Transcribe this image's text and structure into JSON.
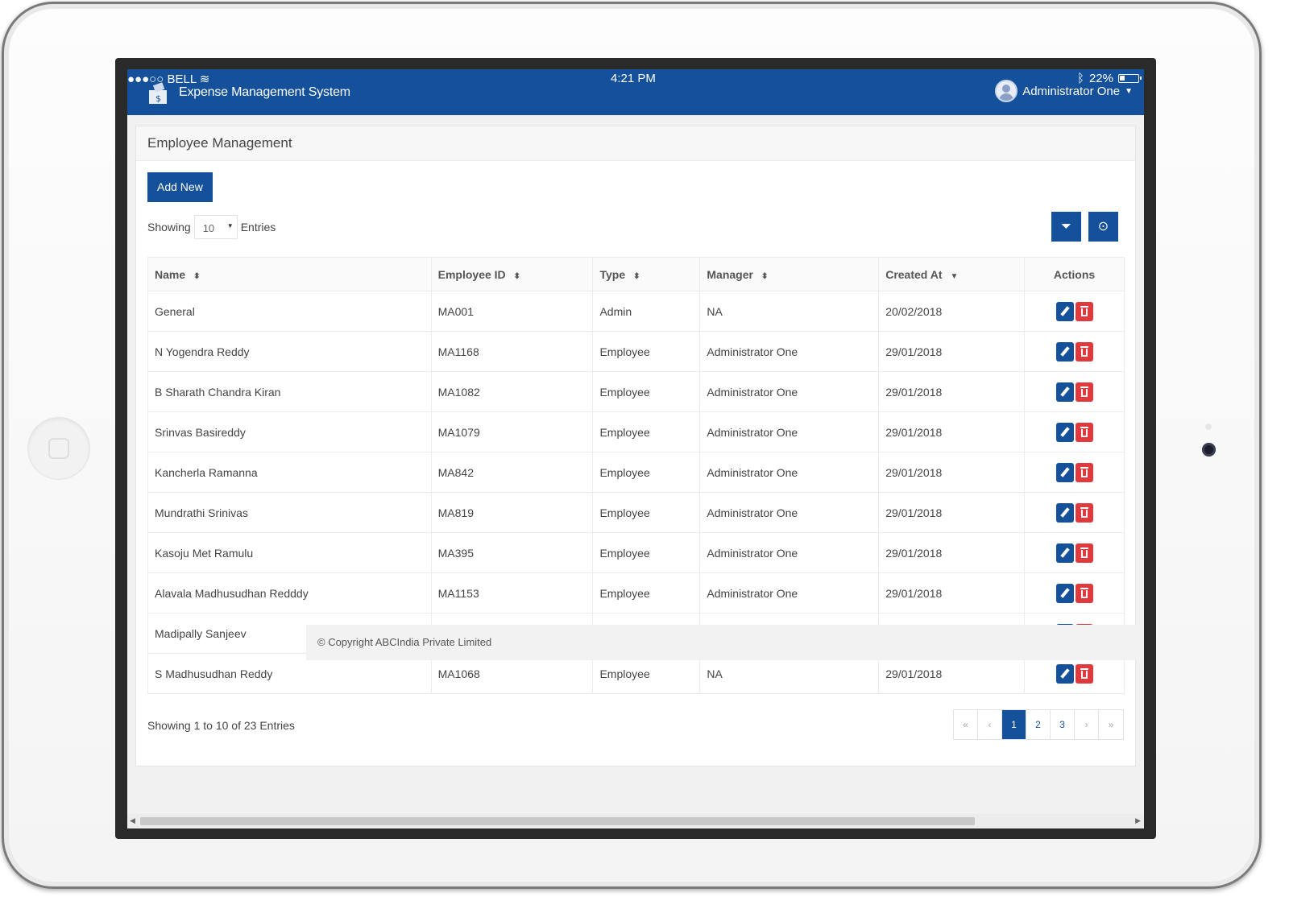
{
  "status_bar": {
    "carrier": "●●●○○ BELL",
    "time": "4:21 PM",
    "battery": "22%"
  },
  "header": {
    "app_title": "Expense Management System",
    "user_name": "Administrator One"
  },
  "panel": {
    "title": "Employee Management",
    "add_button": "Add New",
    "showing_label": "Showing",
    "page_size": "10",
    "entries_label": "Entries"
  },
  "table": {
    "headers": [
      "Name",
      "Employee ID",
      "Type",
      "Manager",
      "Created At",
      "Actions"
    ],
    "rows": [
      [
        "General",
        "MA001",
        "Admin",
        "NA",
        "20/02/2018"
      ],
      [
        "N Yogendra Reddy",
        "MA1168",
        "Employee",
        "Administrator One",
        "29/01/2018"
      ],
      [
        "B Sharath Chandra Kiran",
        "MA1082",
        "Employee",
        "Administrator One",
        "29/01/2018"
      ],
      [
        "Srinvas Basireddy",
        "MA1079",
        "Employee",
        "Administrator One",
        "29/01/2018"
      ],
      [
        "Kancherla Ramanna",
        "MA842",
        "Employee",
        "Administrator One",
        "29/01/2018"
      ],
      [
        "Mundrathi Srinivas",
        "MA819",
        "Employee",
        "Administrator One",
        "29/01/2018"
      ],
      [
        "Kasoju Met Ramulu",
        "MA395",
        "Employee",
        "Administrator One",
        "29/01/2018"
      ],
      [
        "Alavala Madhusudhan Redddy",
        "MA1153",
        "Employee",
        "Administrator One",
        "29/01/2018"
      ],
      [
        "Madipally Sanjeev",
        "",
        "",
        "",
        ""
      ],
      [
        "S Madhusudhan Reddy",
        "MA1068",
        "Employee",
        "NA",
        "29/01/2018"
      ]
    ]
  },
  "copyright": "© Copyright ABCIndia Private Limited",
  "footer": {
    "summary": "Showing 1 to 10 of 23 Entries"
  },
  "pagination": {
    "first": "«",
    "prev": "‹",
    "pages": [
      "1",
      "2",
      "3"
    ],
    "next": "›",
    "last": "»",
    "current": "1"
  },
  "colors": {
    "brand": "#15519a",
    "danger": "#e0393e"
  }
}
